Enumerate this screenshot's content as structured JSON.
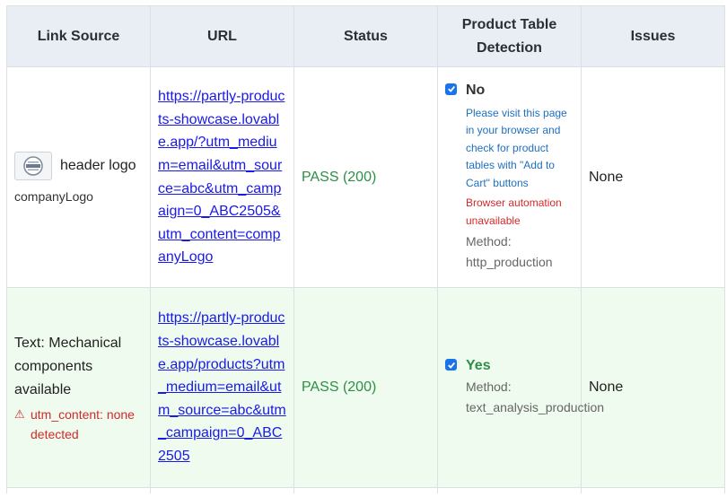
{
  "table": {
    "headers": {
      "link_source": "Link Source",
      "url": "URL",
      "status": "Status",
      "detection_line1": "Product Table",
      "detection_line2": "Detection",
      "issues": "Issues"
    },
    "rows": [
      {
        "source_label": "header logo",
        "source_sub": "companyLogo",
        "url": "https://partly-products-showcase.lovable.app/?utm_medium=email&utm_source=abc&utm_campaign=0_ABC2505&utm_content=companyLogo",
        "status": "PASS (200)",
        "detection": {
          "checked": true,
          "result": "No",
          "message": "Please visit this page in your browser and check for product tables with \"Add to Cart\" buttons",
          "error": "Browser automation unavailable",
          "method": "Method: http_production"
        },
        "issues": "None"
      },
      {
        "source_text": "Text: Mechanical components available",
        "warning": "utm_content: none detected",
        "url": "https://partly-products-showcase.lovable.app/products?utm_medium=email&utm_source=abc&utm_campaign=0_ABC2505",
        "status": "PASS (200)",
        "detection": {
          "checked": true,
          "result": "Yes",
          "method": "Method: text_analysis_production"
        },
        "issues": "None"
      }
    ]
  },
  "colors": {
    "header_bg": "#e9eef4",
    "pass_green": "#2d8f47",
    "warning_red": "#d42a2a",
    "link_blue": "#1a1ae6",
    "info_blue": "#1f6fbf",
    "row_highlight": "#eefbee"
  },
  "icons": {
    "logo_thumbnail": "company-logo-image",
    "checkbox": "checkbox-checked-icon",
    "warning": "warning-triangle-icon"
  }
}
